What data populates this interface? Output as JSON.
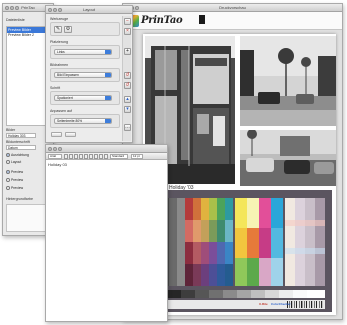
{
  "browser_window": {
    "title": "PrinTao",
    "section1_label": "Dateienliste",
    "list_items": [
      "Preview Bilder",
      "Preview Bilder 2"
    ],
    "filter_label": "Bilder",
    "filter_value": "Holiday 303",
    "subtitle_label": "Bildunterschrift",
    "subtitle_value": "Datum",
    "radio_options": [
      "Ausrichtung",
      "Layout",
      "Preview",
      "Preview",
      "Preview"
    ],
    "area_label": "Hintergrundfarbe"
  },
  "settings_window": {
    "title": "Layout",
    "tools_label": "Werkzeuge",
    "group1_title": "Platzierung",
    "group1_value": "Links",
    "group2_title": "Bildrahmen",
    "group2_value": "Bild Einpassen",
    "group3_title": "Schrift",
    "group3_value": "Spationiert",
    "group4_title": "Anpassen auf",
    "group4_value": "Seitenbreite 80%",
    "tool_icons": [
      "pencil-icon",
      "gear-icon"
    ]
  },
  "preview_window": {
    "title": "Druckvorschau",
    "brand": "PrinTao",
    "caption": "Holiday '03",
    "chart_captions": [
      "X-Rite",
      "ColorChecker"
    ]
  },
  "caption_window": {
    "toolbar_field1": "Arial",
    "toolbar_field2": "Standard",
    "toolbar_field3": "12 pt",
    "text": "Holiday 03"
  },
  "colors": {
    "accent": "#3b78d8",
    "chart_bg": "#5b5560"
  }
}
